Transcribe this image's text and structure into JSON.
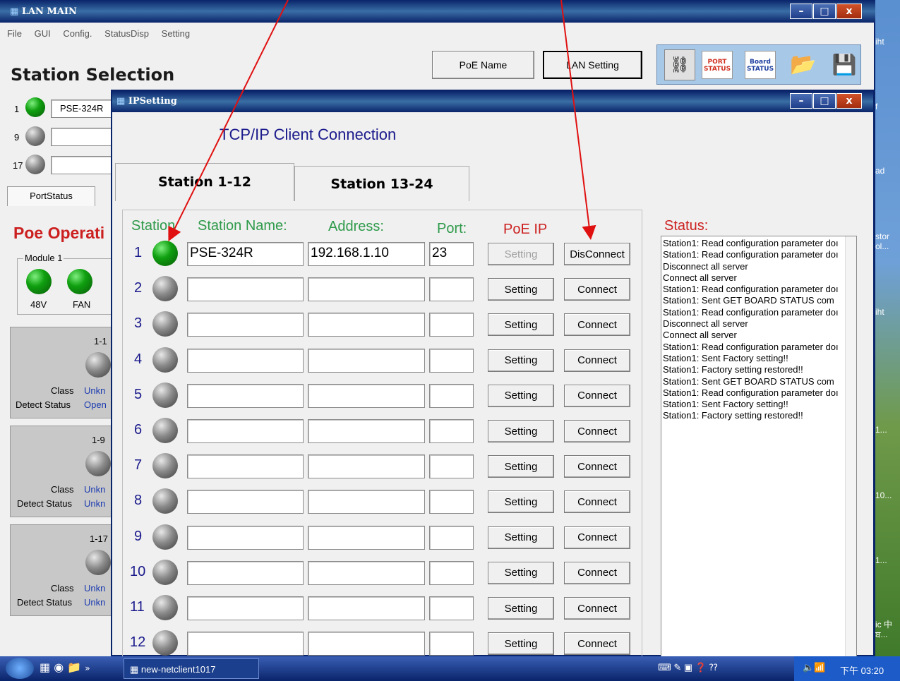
{
  "main_window": {
    "title": "LAN MAIN",
    "menu": [
      "File",
      "GUI",
      "Config.",
      "StatusDisp",
      "Setting"
    ],
    "station_selection_title": "Station Selection",
    "poe_name_button": "PoE Name",
    "lan_setting_button": "LAN Setting",
    "port_status_icon": "PORT STATUS",
    "board_status_icon": "Board STATUS",
    "stations": [
      {
        "num": "1",
        "name": "PSE-324R"
      },
      {
        "num": "9",
        "name": ""
      },
      {
        "num": "17",
        "name": ""
      }
    ],
    "tab_port_status": "PortStatus",
    "poe_operation": "Poe Operati",
    "module_label": "Module 1",
    "led_48v": "48V",
    "led_fan": "FAN",
    "ports": [
      {
        "id": "1-1",
        "class_label": "Class",
        "class_val": "Unkn",
        "detect_label": "Detect Status",
        "detect_val": "Open"
      },
      {
        "id": "1-9",
        "class_label": "Class",
        "class_val": "Unkn",
        "detect_label": "Detect Status",
        "detect_val": "Unkn"
      },
      {
        "id": "1-17",
        "class_label": "Class",
        "class_val": "Unkn",
        "detect_label": "Detect Status",
        "detect_val": "Unkn"
      }
    ]
  },
  "ip_window": {
    "title": "IPSetting",
    "heading": "TCP/IP Client Connection",
    "tab_active": "Station 1-12",
    "tab_other": "Station 13-24",
    "col_station": "Station",
    "col_name": "Station Name:",
    "col_address": "Address:",
    "col_port": "Port:",
    "col_poe_ip": "PoE IP",
    "status_label": "Status:",
    "rows": [
      {
        "num": "1",
        "name": "PSE-324R",
        "address": "192.168.1.10",
        "port": "23",
        "setting": "Setting",
        "connect": "DisConnect",
        "led": "green"
      },
      {
        "num": "2",
        "name": "",
        "address": "",
        "port": "",
        "setting": "Setting",
        "connect": "Connect",
        "led": "grey"
      },
      {
        "num": "3",
        "name": "",
        "address": "",
        "port": "",
        "setting": "Setting",
        "connect": "Connect",
        "led": "grey"
      },
      {
        "num": "4",
        "name": "",
        "address": "",
        "port": "",
        "setting": "Setting",
        "connect": "Connect",
        "led": "grey"
      },
      {
        "num": "5",
        "name": "",
        "address": "",
        "port": "",
        "setting": "Setting",
        "connect": "Connect",
        "led": "grey"
      },
      {
        "num": "6",
        "name": "",
        "address": "",
        "port": "",
        "setting": "Setting",
        "connect": "Connect",
        "led": "grey"
      },
      {
        "num": "7",
        "name": "",
        "address": "",
        "port": "",
        "setting": "Setting",
        "connect": "Connect",
        "led": "grey"
      },
      {
        "num": "8",
        "name": "",
        "address": "",
        "port": "",
        "setting": "Setting",
        "connect": "Connect",
        "led": "grey"
      },
      {
        "num": "9",
        "name": "",
        "address": "",
        "port": "",
        "setting": "Setting",
        "connect": "Connect",
        "led": "grey"
      },
      {
        "num": "10",
        "name": "",
        "address": "",
        "port": "",
        "setting": "Setting",
        "connect": "Connect",
        "led": "grey"
      },
      {
        "num": "11",
        "name": "",
        "address": "",
        "port": "",
        "setting": "Setting",
        "connect": "Connect",
        "led": "grey"
      },
      {
        "num": "12",
        "name": "",
        "address": "",
        "port": "",
        "setting": "Setting",
        "connect": "Connect",
        "led": "grey"
      }
    ],
    "status_log": [
      "Station1: Read configuration parameter doı",
      "Station1: Read configuration parameter doı",
      "Disconnect all server",
      "Connect all server",
      "Station1: Read configuration parameter doı",
      "Station1: Sent GET BOARD STATUS com",
      "Station1: Read configuration parameter doı",
      "Disconnect all server",
      "Connect all server",
      "Station1: Read configuration parameter doı",
      "Station1: Sent Factory setting!!",
      "Station1: Factory setting restored!!",
      "Station1: Sent GET BOARD STATUS com",
      "Station1: Read configuration parameter doı",
      "Station1: Sent Factory setting!!",
      "Station1: Factory setting restored!!"
    ]
  },
  "desktop_side_labels": [
    "iht",
    "f",
    "ad",
    "stor",
    "ol...",
    "iht",
    "1...",
    "10...",
    "1...",
    "ic 中",
    "ਬ..."
  ],
  "taskbar": {
    "task": "new-netclient1017",
    "clock": "下午 03:20"
  },
  "colors": {
    "titlebar": "#0a246a",
    "heading_blue": "#1a1a8c",
    "label_green": "#2e9a4a",
    "poe_red": "#cc2020"
  }
}
